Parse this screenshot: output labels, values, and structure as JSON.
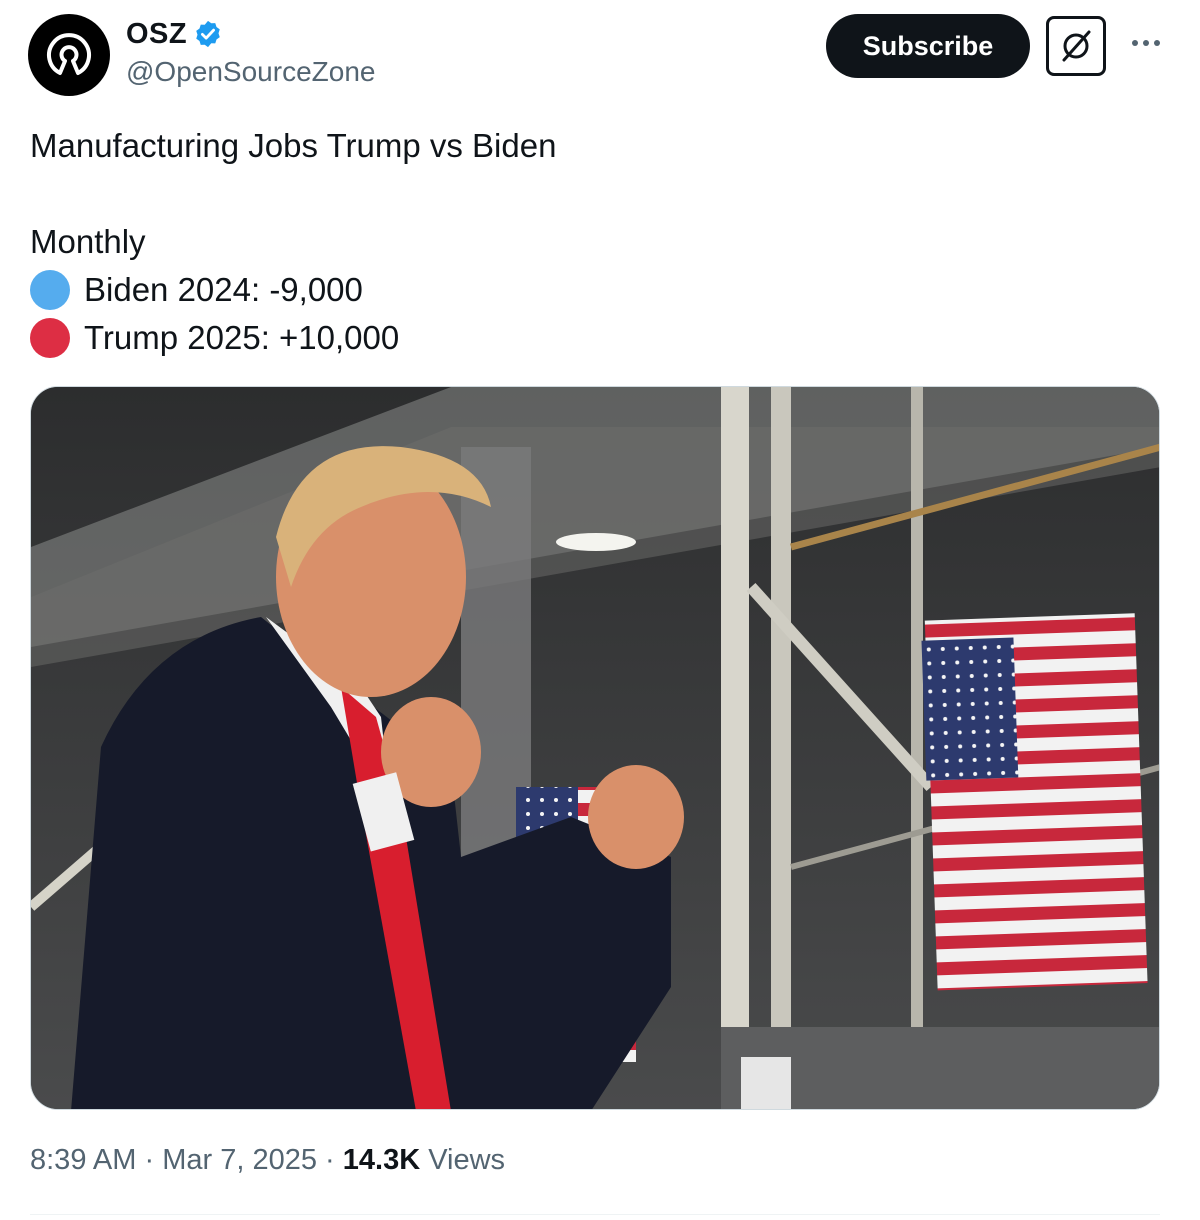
{
  "author": {
    "display_name": "OSZ",
    "handle": "@OpenSourceZone",
    "verified": true,
    "avatar_icon": "open-source-logo-icon"
  },
  "actions": {
    "subscribe_label": "Subscribe",
    "grok_icon": "grok-icon",
    "more_icon": "more-options-icon"
  },
  "post": {
    "title_line": "Manufacturing Jobs Trump vs Biden",
    "subtitle_line": "Monthly",
    "items": [
      {
        "label": "Biden 2024: -9,000",
        "color": "#55acee"
      },
      {
        "label": "Trump 2025: +10,000",
        "color": "#dd2e44"
      }
    ]
  },
  "meta": {
    "time": "8:39 AM",
    "separator": "·",
    "date": "Mar 7, 2025",
    "views_count": "14.3K",
    "views_label": "Views"
  },
  "colors": {
    "text_primary": "#0f1419",
    "text_secondary": "#536471",
    "verified_blue": "#1d9bf0"
  }
}
